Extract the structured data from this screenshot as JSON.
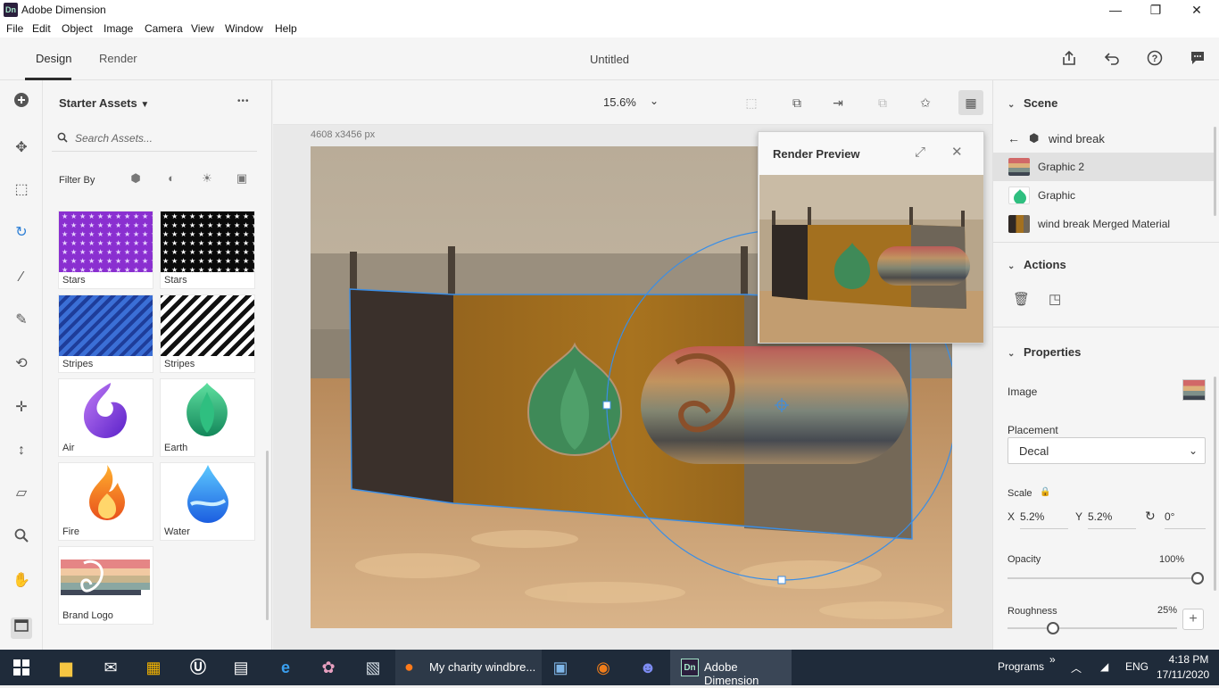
{
  "window": {
    "app_title": "Adobe Dimension",
    "app_icon": "Dn",
    "minimize": "—",
    "maximize": "❐",
    "close": "✕"
  },
  "menu": [
    "File",
    "Edit",
    "Object",
    "Image",
    "Camera",
    "View",
    "Window",
    "Help"
  ],
  "header": {
    "tab_design": "Design",
    "tab_render": "Render",
    "doc_title": "Untitled"
  },
  "assets": {
    "title": "Starter Assets",
    "more": "•••",
    "search_placeholder": "Search Assets...",
    "filter_label": "Filter By",
    "items": [
      {
        "label": "Stars"
      },
      {
        "label": "Stars"
      },
      {
        "label": "Stripes"
      },
      {
        "label": "Stripes"
      },
      {
        "label": "Air"
      },
      {
        "label": "Earth"
      },
      {
        "label": "Fire"
      },
      {
        "label": "Water"
      },
      {
        "label": "Brand Logo"
      }
    ]
  },
  "canvas": {
    "zoom": "15.6%",
    "dimensions": "4608 x3456 px"
  },
  "render_preview": {
    "title": "Render Preview"
  },
  "scene": {
    "title": "Scene",
    "parent": "wind break",
    "items": [
      {
        "name": "Graphic 2"
      },
      {
        "name": "Graphic"
      },
      {
        "name": "wind break Merged Material"
      }
    ]
  },
  "actions": {
    "title": "Actions"
  },
  "properties": {
    "title": "Properties",
    "image_label": "Image",
    "placement_label": "Placement",
    "placement_value": "Decal",
    "scale_label": "Scale",
    "scale_x_label": "X",
    "scale_x": "5.2%",
    "scale_y_label": "Y",
    "scale_y": "5.2%",
    "rotation": "0°",
    "opacity_label": "Opacity",
    "opacity_value": "100%",
    "opacity": 1.0,
    "roughness_label": "Roughness",
    "roughness_value": "25%",
    "roughness": 0.25
  },
  "taskbar": {
    "firefox_title": "My charity windbre...",
    "dimension_title": "Adobe Dimension",
    "programs": "Programs",
    "programs_chevron": "»",
    "lang": "ENG",
    "time": "4:18 PM",
    "date": "17/11/2020"
  },
  "colors": {
    "accent_selection": "#3a8ee6",
    "taskbar": "#1f2b3a"
  }
}
